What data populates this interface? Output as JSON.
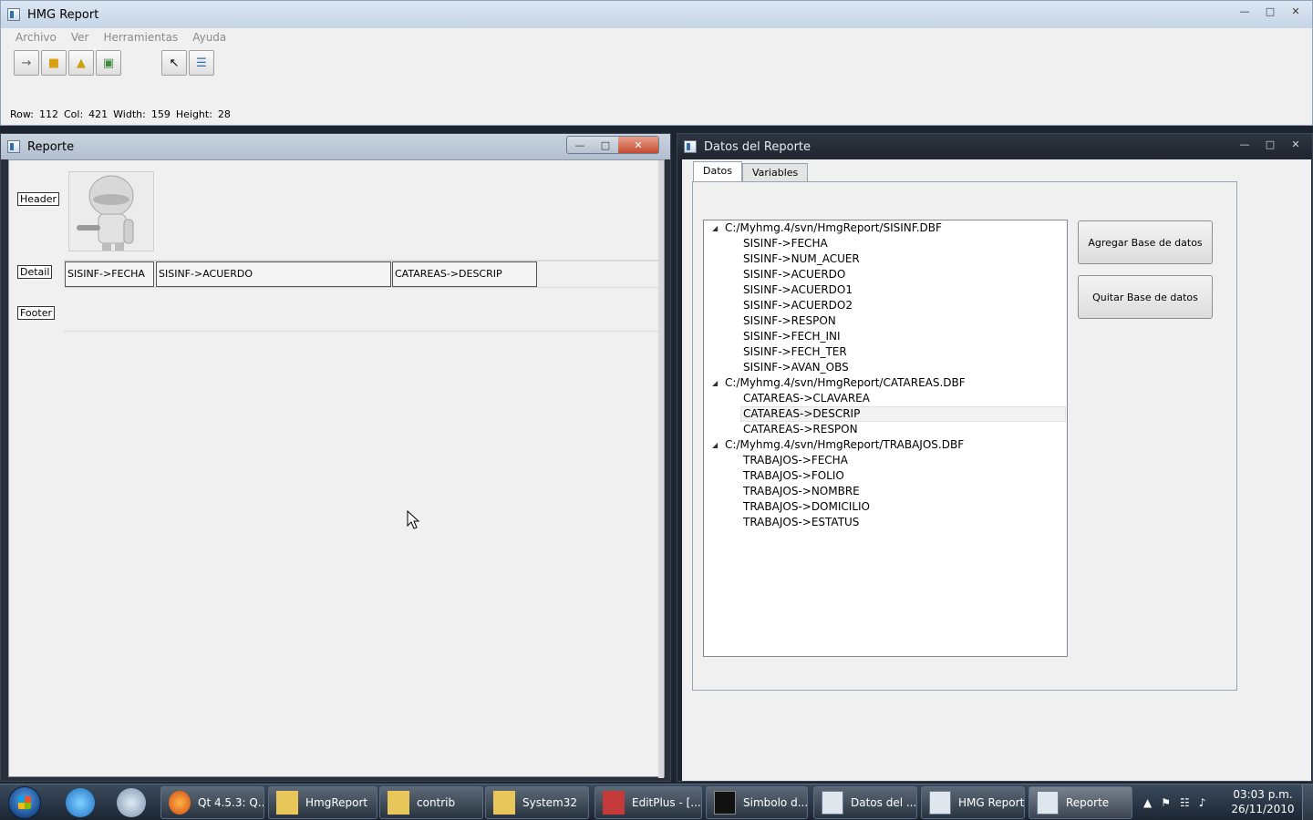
{
  "main_window": {
    "title": "HMG Report",
    "menu": [
      "Archivo",
      "Ver",
      "Herramientas",
      "Ayuda"
    ],
    "toolbar_icons": [
      "arrow-icon",
      "open-folder-icon",
      "folder-icon",
      "save-icon",
      "pointer-icon",
      "properties-icon"
    ],
    "status": {
      "row_label": "Row:",
      "row_value": "112",
      "col_label": "Col:",
      "col_value": "421",
      "width_label": "Width:",
      "width_value": "159",
      "height_label": "Height:",
      "height_value": "28"
    }
  },
  "reporte_window": {
    "title": "Reporte",
    "bands": {
      "header": "Header",
      "detail": "Detail",
      "footer": "Footer"
    },
    "detail_fields": [
      "SISINF->FECHA",
      "SISINF->ACUERDO",
      "CATAREAS->DESCRIP"
    ]
  },
  "datos_window": {
    "title": "Datos del Reporte",
    "tabs": [
      "Datos",
      "Variables"
    ],
    "tree": [
      {
        "db": "C:/Myhmg.4/svn/HmgReport/SISINF.DBF",
        "fields": [
          "SISINF->FECHA",
          "SISINF->NUM_ACUER",
          "SISINF->ACUERDO",
          "SISINF->ACUERDO1",
          "SISINF->ACUERDO2",
          "SISINF->RESPON",
          "SISINF->FECH_INI",
          "SISINF->FECH_TER",
          "SISINF->AVAN_OBS"
        ]
      },
      {
        "db": "C:/Myhmg.4/svn/HmgReport/CATAREAS.DBF",
        "fields": [
          "CATAREAS->CLAVAREA",
          "CATAREAS->DESCRIP",
          "CATAREAS->RESPON"
        ]
      },
      {
        "db": "C:/Myhmg.4/svn/HmgReport/TRABAJOS.DBF",
        "fields": [
          "TRABAJOS->FECHA",
          "TRABAJOS->FOLIO",
          "TRABAJOS->NOMBRE",
          "TRABAJOS->DOMICILIO",
          "TRABAJOS->ESTATUS"
        ]
      }
    ],
    "selected_field": "CATAREAS->DESCRIP",
    "buttons": {
      "add": "Agregar Base de datos",
      "remove": "Quitar Base de datos"
    }
  },
  "taskbar": {
    "tasks": [
      "Qt 4.5.3: Q...",
      "HmgReport",
      "contrib",
      "System32",
      "EditPlus - [...",
      "Simbolo d...",
      "Datos del ...",
      "HMG Report",
      "Reporte"
    ],
    "clock_time": "03:03 p.m.",
    "clock_date": "26/11/2010"
  }
}
